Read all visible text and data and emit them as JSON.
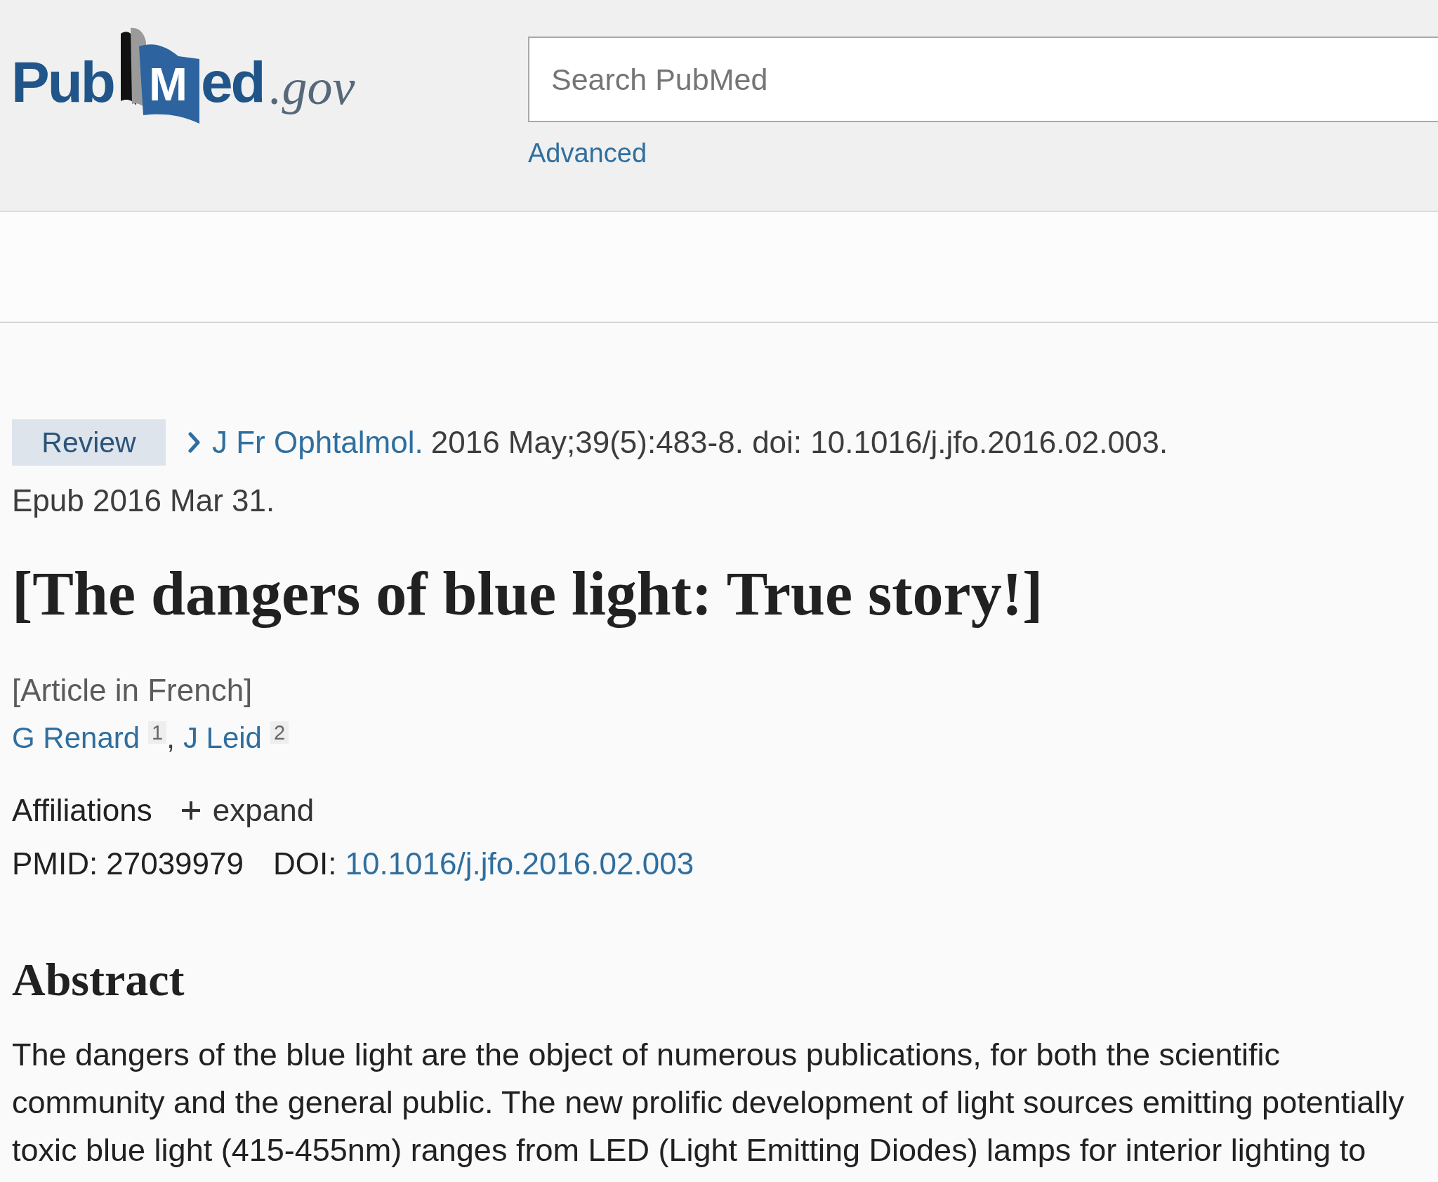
{
  "header": {
    "logo": {
      "start": "Pub",
      "book_letter": "M",
      "end": "ed",
      "domain": ".gov"
    },
    "search": {
      "placeholder": "Search PubMed"
    },
    "advanced_link": "Advanced"
  },
  "article": {
    "publication_type": "Review",
    "journal": "J Fr Ophtalmol.",
    "citation": "2016 May;39(5):483-8. doi: 10.1016/j.jfo.2016.02.003.",
    "epub": "Epub 2016 Mar 31.",
    "title": "[The dangers of blue light: True story!]",
    "language_note": "[Article in French]",
    "authors": [
      {
        "name": "G Renard",
        "affiliation": "1"
      },
      {
        "name": "J Leid",
        "affiliation": "2"
      }
    ],
    "author_separator": ",",
    "affiliations": {
      "label": "Affiliations",
      "toggle": "expand",
      "expanded": false
    },
    "identifiers": [
      {
        "kind": "plain",
        "label": "PMID:",
        "value": "27039979"
      },
      {
        "kind": "link",
        "label": "DOI:",
        "value": "10.1016/j.jfo.2016.02.003"
      }
    ]
  },
  "abstract": {
    "heading": "Abstract",
    "text": "The dangers of the blue light are the object of numerous publications, for both the scientific community and the general public. The new prolific development of light sources emitting potentially toxic blue light (415-455nm) ranges from LED (Light Emitting Diodes) lamps for interior lighting to"
  }
}
